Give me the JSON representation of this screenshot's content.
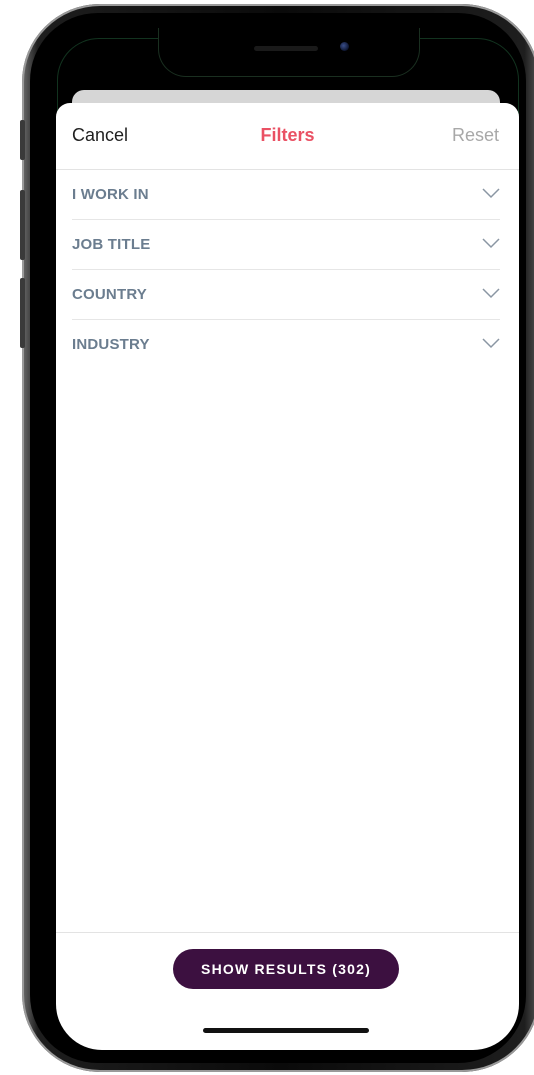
{
  "nav": {
    "cancel_label": "Cancel",
    "title": "Filters",
    "reset_label": "Reset"
  },
  "filters": [
    {
      "label": "I WORK IN",
      "icon": "chevron-down-icon"
    },
    {
      "label": "JOB TITLE",
      "icon": "chevron-down-icon"
    },
    {
      "label": "COUNTRY",
      "icon": "chevron-down-icon"
    },
    {
      "label": "INDUSTRY",
      "icon": "chevron-down-icon"
    }
  ],
  "footer": {
    "show_results_label": "SHOW RESULTS (302)"
  },
  "colors": {
    "accent": "#ea5164",
    "button": "#3c1040",
    "filter_label": "#6b7d8f",
    "reset": "#a8a8a8"
  }
}
